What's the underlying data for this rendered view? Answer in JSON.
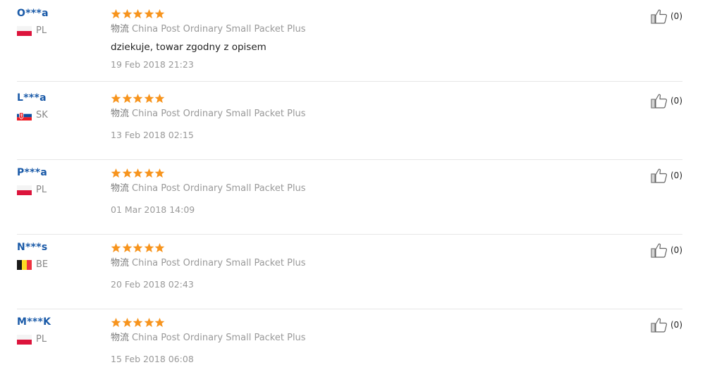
{
  "reviews": [
    {
      "user": "O***a",
      "country": "PL",
      "flag": "pl",
      "stars": 5,
      "logistics_label": "物流",
      "logistics": "China Post Ordinary Small Packet Plus",
      "feedback": "dziekuje, towar zgodny z opisem",
      "date": "19 Feb 2018 21:23",
      "helpful": "(0)"
    },
    {
      "user": "L***a",
      "country": "SK",
      "flag": "sk",
      "stars": 5,
      "logistics_label": "物流",
      "logistics": "China Post Ordinary Small Packet Plus",
      "feedback": "",
      "date": "13 Feb 2018 02:15",
      "helpful": "(0)"
    },
    {
      "user": "P***a",
      "country": "PL",
      "flag": "pl",
      "stars": 5,
      "logistics_label": "物流",
      "logistics": "China Post Ordinary Small Packet Plus",
      "feedback": "",
      "date": "01 Mar 2018 14:09",
      "helpful": "(0)"
    },
    {
      "user": "N***s",
      "country": "BE",
      "flag": "be",
      "stars": 5,
      "logistics_label": "物流",
      "logistics": "China Post Ordinary Small Packet Plus",
      "feedback": "",
      "date": "20 Feb 2018 02:43",
      "helpful": "(0)"
    },
    {
      "user": "M***K",
      "country": "PL",
      "flag": "pl",
      "stars": 5,
      "logistics_label": "物流",
      "logistics": "China Post Ordinary Small Packet Plus",
      "feedback": "",
      "date": "15 Feb 2018 06:08",
      "helpful": "(0)"
    }
  ],
  "colors": {
    "star": "#f7941d",
    "username": "#1a5aa8"
  },
  "icons": {
    "star": "star-icon",
    "helpful": "thumbs-up-icon"
  }
}
